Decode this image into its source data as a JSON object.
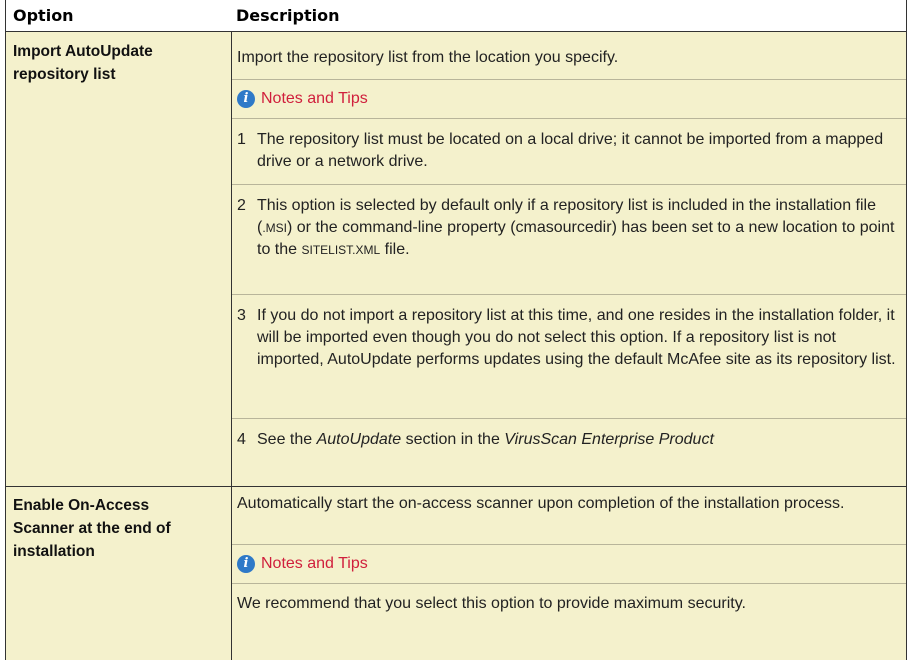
{
  "header": {
    "option": "Option",
    "description": "Description"
  },
  "rows": [
    {
      "option": [
        "Import AutoUpdate",
        "repository list"
      ],
      "description": "Import the repository list from the location you specify.",
      "notes_label": "Notes and Tips",
      "items": [
        {
          "num": "1",
          "text": "The repository list must be located on a local drive; it cannot be imported from a mapped drive or a network drive."
        },
        {
          "num": "2",
          "text_a": "This option is selected by default only if a repository list is included in the installation file (",
          "sc_a": ".MSI",
          "text_b": ") or the command-line property (cmasourcedir) has been set to a new location to point to the ",
          "sc_b": "SITELIST.XML",
          "text_c": " file."
        },
        {
          "num": "3",
          "text": "If you do not import a repository list at this time, and one resides in the installation folder, it will be imported even though you do not select this option. If a repository list is not imported, AutoUpdate performs updates using the default McAfee site as its repository list."
        },
        {
          "num": "4",
          "text_a": "See the ",
          "em_a": "AutoUpdate",
          "text_b": " section in the ",
          "em_b": "VirusScan Enterprise Product"
        }
      ]
    },
    {
      "option": [
        "Enable On-Access",
        "Scanner at the end of",
        "installation"
      ],
      "description": "Automatically start the on-access scanner upon completion of the installation process.",
      "notes_label": "Notes and Tips",
      "note_text": "We recommend that you select this option to provide maximum security."
    }
  ],
  "colors": {
    "row_bg": "#f4f1cc",
    "note_red": "#d01f3c",
    "info_blue": "#2e79c8"
  },
  "icons": {
    "note": "info-icon"
  }
}
